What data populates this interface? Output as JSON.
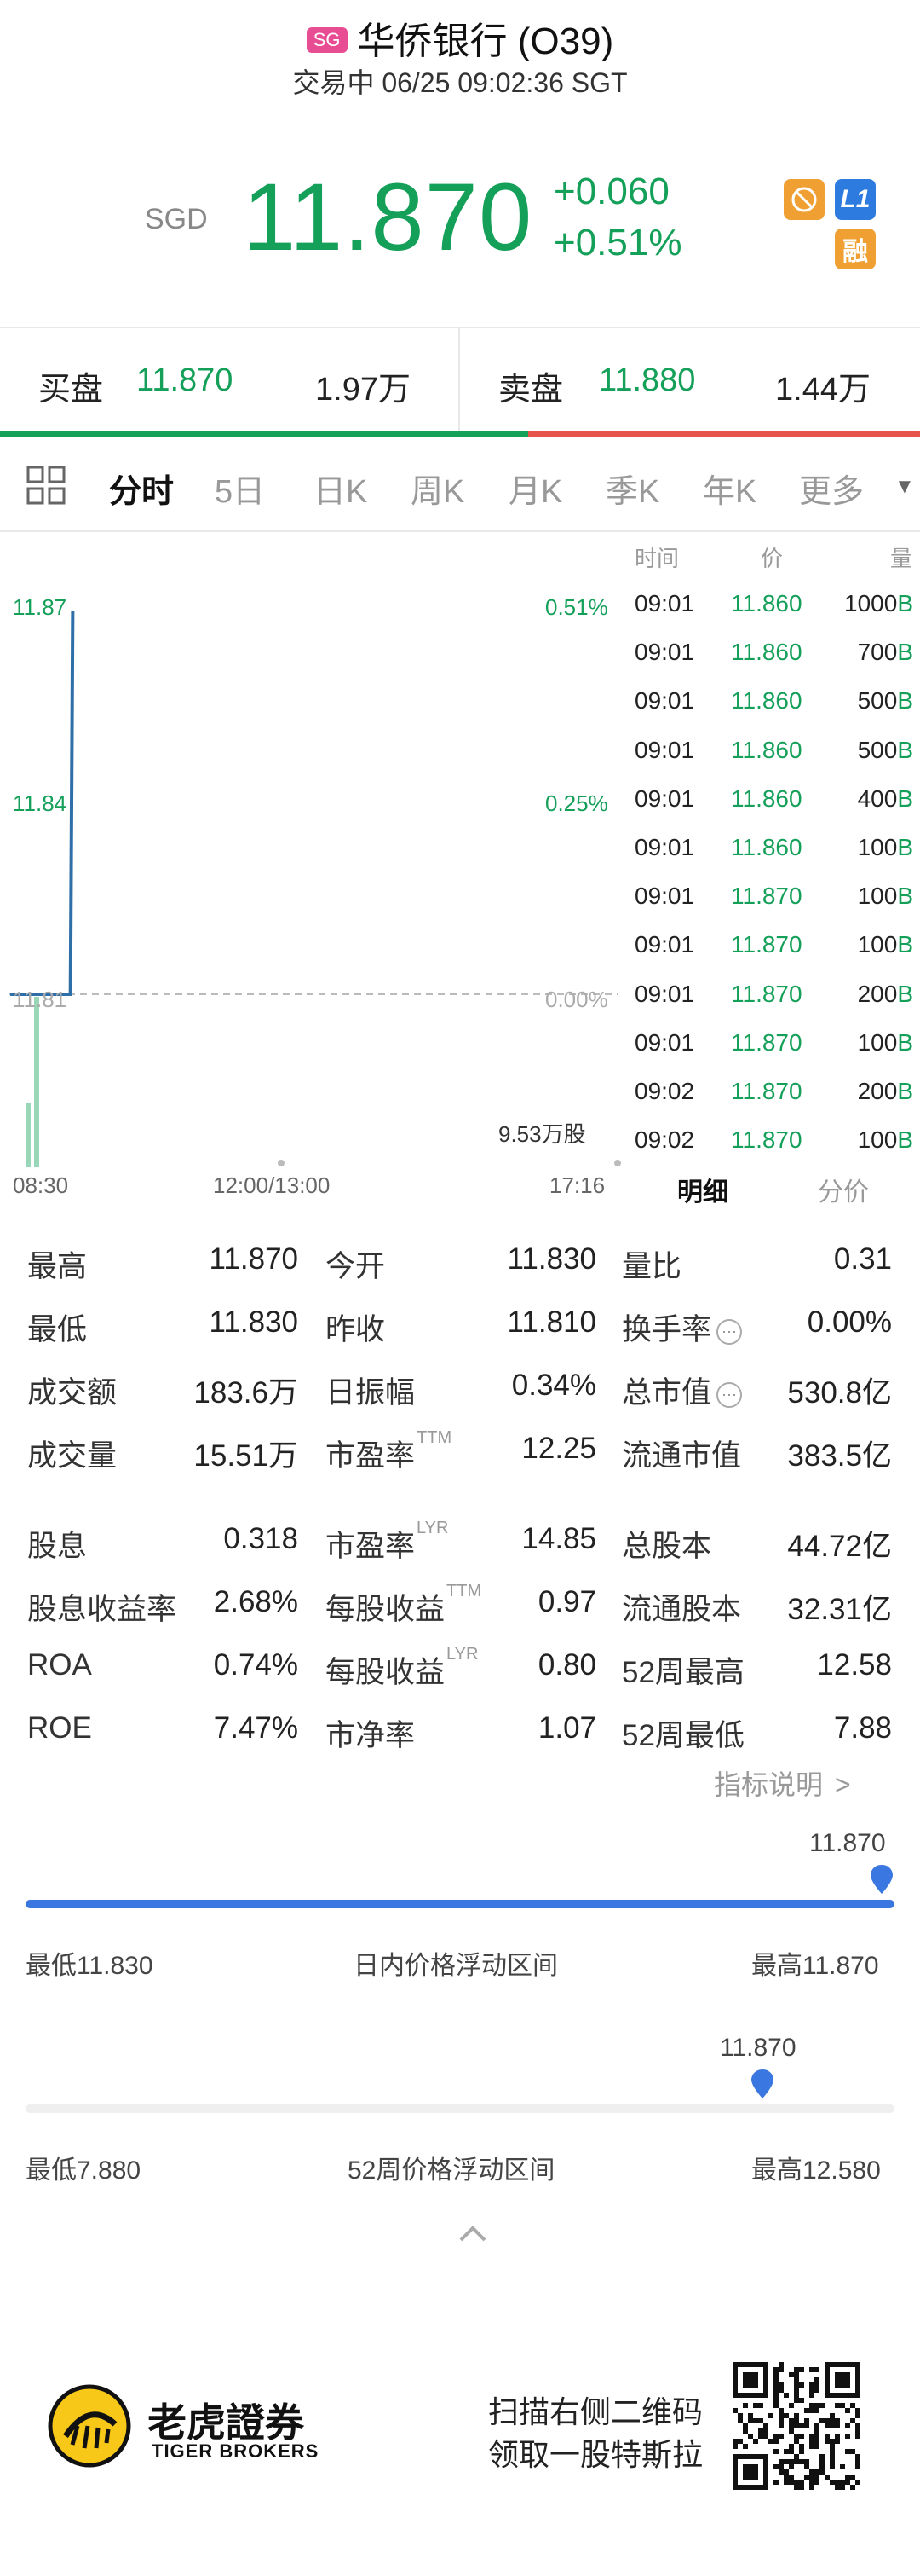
{
  "header": {
    "market_badge": "SG",
    "title": "华侨银行 (O39)",
    "status": "交易中 06/25 09:02:36 SGT"
  },
  "quote": {
    "currency": "SGD",
    "price": "11.870",
    "change": "+0.060",
    "change_pct": "+0.51%",
    "tag_l1": "L1",
    "tag_rong": "融"
  },
  "bidask": {
    "bid_label": "买盘",
    "bid_price": "11.870",
    "bid_vol": "1.97万",
    "ask_label": "卖盘",
    "ask_price": "11.880",
    "ask_vol": "1.44万"
  },
  "tabs": [
    "分时",
    "5日",
    "日K",
    "周K",
    "月K",
    "季K",
    "年K",
    "更多"
  ],
  "chart": {
    "y_top": "11.87",
    "y_mid": "11.84",
    "y_base": "11.81",
    "pct_top": "0.51%",
    "pct_mid": "0.25%",
    "pct_base": "0.00%",
    "volume_label": "9.53万股",
    "x_start": "08:30",
    "x_mid": "12:00/13:00",
    "x_end": "17:16"
  },
  "chart_data": {
    "type": "line",
    "x": [
      "08:30",
      "09:00",
      "09:01",
      "09:02"
    ],
    "y": [
      11.81,
      11.81,
      11.84,
      11.87
    ],
    "ylim": [
      11.76,
      11.88
    ],
    "baseline": 11.81
  },
  "trades": {
    "headers": [
      "时间",
      "价",
      "量"
    ],
    "rows": [
      {
        "time": "09:01",
        "price": "11.860",
        "vol": "1000",
        "side": "B"
      },
      {
        "time": "09:01",
        "price": "11.860",
        "vol": "700",
        "side": "B"
      },
      {
        "time": "09:01",
        "price": "11.860",
        "vol": "500",
        "side": "B"
      },
      {
        "time": "09:01",
        "price": "11.860",
        "vol": "500",
        "side": "B"
      },
      {
        "time": "09:01",
        "price": "11.860",
        "vol": "400",
        "side": "B"
      },
      {
        "time": "09:01",
        "price": "11.860",
        "vol": "100",
        "side": "B"
      },
      {
        "time": "09:01",
        "price": "11.870",
        "vol": "100",
        "side": "B"
      },
      {
        "time": "09:01",
        "price": "11.870",
        "vol": "100",
        "side": "B"
      },
      {
        "time": "09:01",
        "price": "11.870",
        "vol": "200",
        "side": "B"
      },
      {
        "time": "09:01",
        "price": "11.870",
        "vol": "100",
        "side": "B"
      },
      {
        "time": "09:02",
        "price": "11.870",
        "vol": "200",
        "side": "B"
      },
      {
        "time": "09:02",
        "price": "11.870",
        "vol": "100",
        "side": "B"
      }
    ],
    "tab_detail": "明细",
    "tab_price": "分价"
  },
  "stats": {
    "high_l": "最高",
    "high_v": "11.870",
    "open_l": "今开",
    "open_v": "11.830",
    "vr_l": "量比",
    "vr_v": "0.31",
    "low_l": "最低",
    "low_v": "11.830",
    "prev_l": "昨收",
    "prev_v": "11.810",
    "turn_l": "换手率",
    "turn_v": "0.00%",
    "amt_l": "成交额",
    "amt_v": "183.6万",
    "amp_l": "日振幅",
    "amp_v": "0.34%",
    "mcap_l": "总市值",
    "mcap_v": "530.8亿",
    "vol_l": "成交量",
    "vol_v": "15.51万",
    "pe_ttm_l": "市盈率",
    "pe_ttm_sup": "TTM",
    "pe_ttm_v": "12.25",
    "fmcap_l": "流通市值",
    "fmcap_v": "383.5亿",
    "div_l": "股息",
    "div_v": "0.318",
    "pe_lyr_l": "市盈率",
    "pe_lyr_sup": "LYR",
    "pe_lyr_v": "14.85",
    "shares_l": "总股本",
    "shares_v": "44.72亿",
    "dy_l": "股息收益率",
    "dy_v": "2.68%",
    "eps_ttm_l": "每股收益",
    "eps_ttm_sup": "TTM",
    "eps_ttm_v": "0.97",
    "fshares_l": "流通股本",
    "fshares_v": "32.31亿",
    "roa_l": "ROA",
    "roa_v": "0.74%",
    "eps_lyr_l": "每股收益",
    "eps_lyr_sup": "LYR",
    "eps_lyr_v": "0.80",
    "w52h_l": "52周最高",
    "w52h_v": "12.58",
    "roe_l": "ROE",
    "roe_v": "7.47%",
    "pb_l": "市净率",
    "pb_v": "1.07",
    "w52l_l": "52周最低",
    "w52l_v": "7.88",
    "indicator_link": "指标说明"
  },
  "ranges": {
    "day": {
      "current": "11.870",
      "low_label": "最低11.830",
      "title": "日内价格浮动区间",
      "high_label": "最高11.870",
      "position": 1.0
    },
    "week52": {
      "current": "11.870",
      "low_label": "最低7.880",
      "title": "52周价格浮动区间",
      "high_label": "最高12.580",
      "position": 0.85
    }
  },
  "footer": {
    "brand_cn": "老虎證券",
    "brand_en": "TIGER BROKERS",
    "promo_line1": "扫描右侧二维码",
    "promo_line2": "领取一股特斯拉"
  },
  "colors": {
    "up": "#15a05a",
    "down": "#e5534b",
    "line": "#2f6fa8",
    "range_bar": "#3b77e0"
  }
}
